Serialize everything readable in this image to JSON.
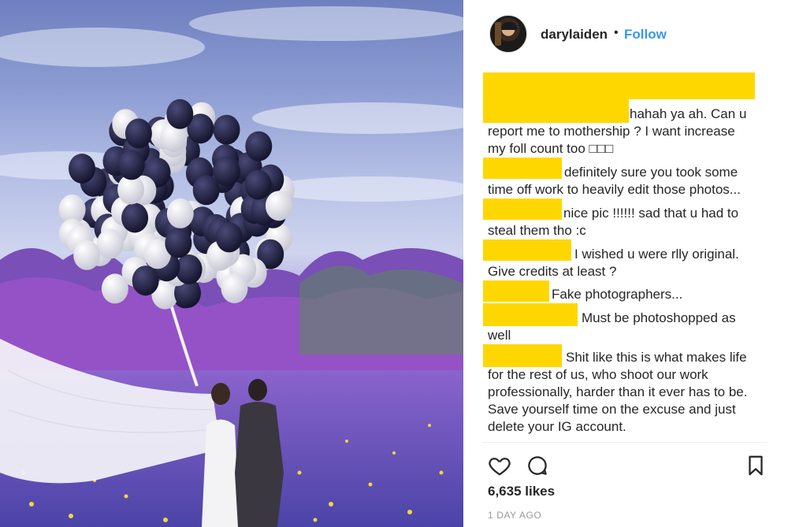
{
  "post": {
    "username": "darylaiden",
    "separator": "•",
    "follow_label": "Follow",
    "likes": "6,635 likes",
    "timestamp": "1 DAY AGO"
  },
  "comments": [
    {
      "text": "hahah ya ah. Can u\nreport me to mothership ? I want increase\nmy foll count too □□□"
    },
    {
      "text": "definitely sure you took some\ntime off work to heavily edit those photos..."
    },
    {
      "text": "nice pic !!!!!! sad that u had to\nsteal them tho :c"
    },
    {
      "text": "I wished u were rlly original.\nGive credits at least ?"
    },
    {
      "text": "Fake photographers..."
    },
    {
      "text": "Must be photoshopped as\nwell"
    },
    {
      "text": "Shit like this is what makes life\nfor the rest of us, who shoot our work\nprofessionally, harder than it ever has to be.\nSave yourself time on the excuse and just\ndelete your IG account."
    }
  ],
  "icons": {
    "like": "heart-icon",
    "comment": "comment-bubble-icon",
    "save": "bookmark-icon"
  },
  "colors": {
    "redaction": "#ffd700",
    "follow": "#3897f0",
    "text": "#262626",
    "timestamp": "#999999"
  }
}
